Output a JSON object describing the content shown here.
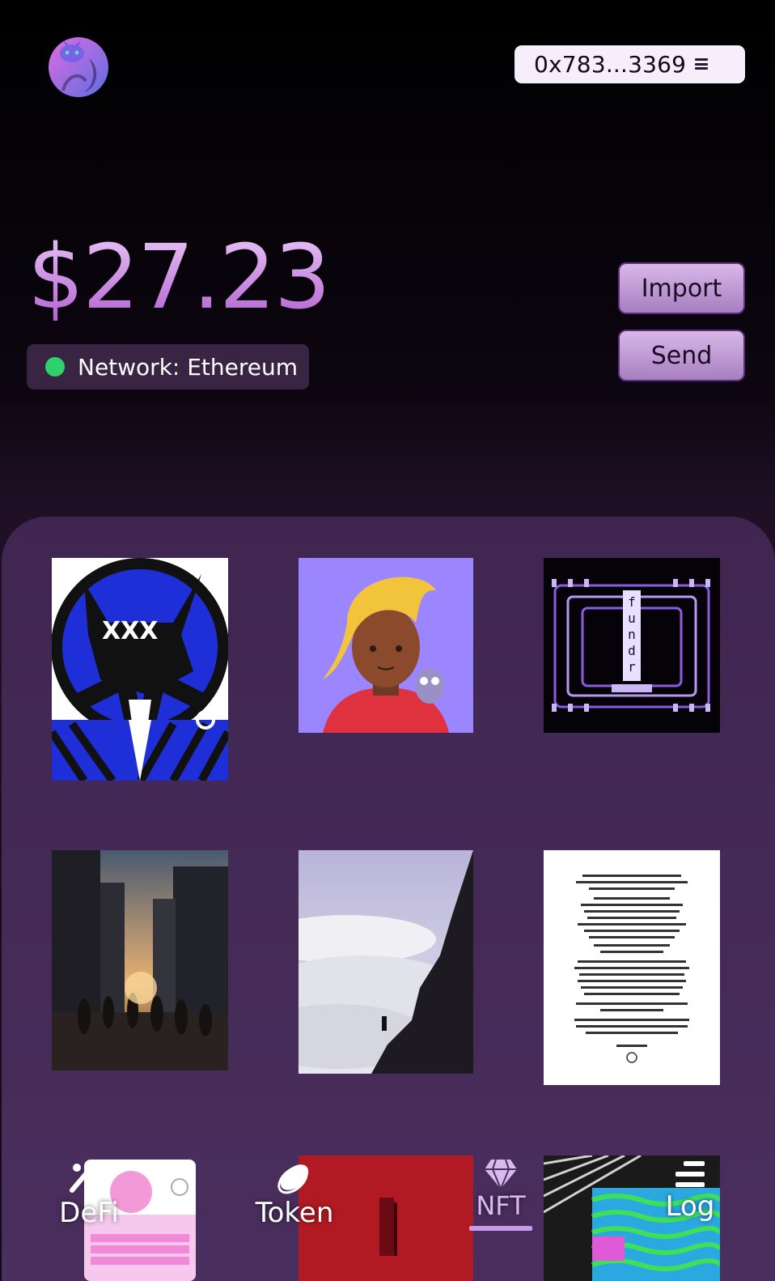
{
  "header": {
    "wallet_address": "0x783...3369",
    "logo_icon": "cat-moon-logo-icon",
    "menu_icon": "hamburger-menu-icon"
  },
  "balance": {
    "amount": "$27.23"
  },
  "network": {
    "label": "Network: Ethereum",
    "status_color": "#2fd26a"
  },
  "actions": {
    "import_label": "Import",
    "send_label": "Send"
  },
  "gallery": {
    "nfts": [
      {
        "name": "nft-monster-cat-art"
      },
      {
        "name": "nft-avatar-with-owl"
      },
      {
        "name": "nft-fundrop-pattern"
      },
      {
        "name": "nft-city-street-sunset"
      },
      {
        "name": "nft-mountain-clouds"
      },
      {
        "name": "nft-zora-manifesto"
      },
      {
        "name": "nft-proposals-card"
      },
      {
        "name": "nft-red-door"
      },
      {
        "name": "nft-glitch-pattern"
      }
    ]
  },
  "nav": {
    "defi_label": "DeFi",
    "token_label": "Token",
    "nft_label": "NFT",
    "log_label": "Log",
    "active": "NFT",
    "active_color": "#c79be6"
  },
  "colors": {
    "accent": "#b25fd0",
    "panel": "#4a2f5e",
    "button": "#c7a6dc"
  }
}
